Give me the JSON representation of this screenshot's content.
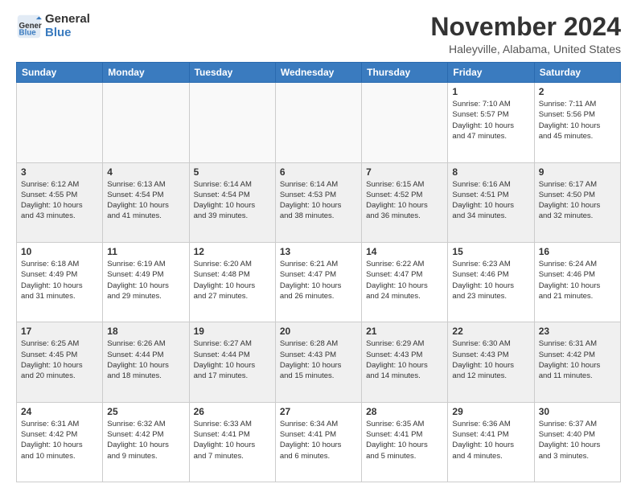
{
  "header": {
    "logo_general": "General",
    "logo_blue": "Blue",
    "month_title": "November 2024",
    "location": "Haleyville, Alabama, United States"
  },
  "weekdays": [
    "Sunday",
    "Monday",
    "Tuesday",
    "Wednesday",
    "Thursday",
    "Friday",
    "Saturday"
  ],
  "weeks": [
    [
      {
        "day": "",
        "info": ""
      },
      {
        "day": "",
        "info": ""
      },
      {
        "day": "",
        "info": ""
      },
      {
        "day": "",
        "info": ""
      },
      {
        "day": "",
        "info": ""
      },
      {
        "day": "1",
        "info": "Sunrise: 7:10 AM\nSunset: 5:57 PM\nDaylight: 10 hours\nand 47 minutes."
      },
      {
        "day": "2",
        "info": "Sunrise: 7:11 AM\nSunset: 5:56 PM\nDaylight: 10 hours\nand 45 minutes."
      }
    ],
    [
      {
        "day": "3",
        "info": "Sunrise: 6:12 AM\nSunset: 4:55 PM\nDaylight: 10 hours\nand 43 minutes."
      },
      {
        "day": "4",
        "info": "Sunrise: 6:13 AM\nSunset: 4:54 PM\nDaylight: 10 hours\nand 41 minutes."
      },
      {
        "day": "5",
        "info": "Sunrise: 6:14 AM\nSunset: 4:54 PM\nDaylight: 10 hours\nand 39 minutes."
      },
      {
        "day": "6",
        "info": "Sunrise: 6:14 AM\nSunset: 4:53 PM\nDaylight: 10 hours\nand 38 minutes."
      },
      {
        "day": "7",
        "info": "Sunrise: 6:15 AM\nSunset: 4:52 PM\nDaylight: 10 hours\nand 36 minutes."
      },
      {
        "day": "8",
        "info": "Sunrise: 6:16 AM\nSunset: 4:51 PM\nDaylight: 10 hours\nand 34 minutes."
      },
      {
        "day": "9",
        "info": "Sunrise: 6:17 AM\nSunset: 4:50 PM\nDaylight: 10 hours\nand 32 minutes."
      }
    ],
    [
      {
        "day": "10",
        "info": "Sunrise: 6:18 AM\nSunset: 4:49 PM\nDaylight: 10 hours\nand 31 minutes."
      },
      {
        "day": "11",
        "info": "Sunrise: 6:19 AM\nSunset: 4:49 PM\nDaylight: 10 hours\nand 29 minutes."
      },
      {
        "day": "12",
        "info": "Sunrise: 6:20 AM\nSunset: 4:48 PM\nDaylight: 10 hours\nand 27 minutes."
      },
      {
        "day": "13",
        "info": "Sunrise: 6:21 AM\nSunset: 4:47 PM\nDaylight: 10 hours\nand 26 minutes."
      },
      {
        "day": "14",
        "info": "Sunrise: 6:22 AM\nSunset: 4:47 PM\nDaylight: 10 hours\nand 24 minutes."
      },
      {
        "day": "15",
        "info": "Sunrise: 6:23 AM\nSunset: 4:46 PM\nDaylight: 10 hours\nand 23 minutes."
      },
      {
        "day": "16",
        "info": "Sunrise: 6:24 AM\nSunset: 4:46 PM\nDaylight: 10 hours\nand 21 minutes."
      }
    ],
    [
      {
        "day": "17",
        "info": "Sunrise: 6:25 AM\nSunset: 4:45 PM\nDaylight: 10 hours\nand 20 minutes."
      },
      {
        "day": "18",
        "info": "Sunrise: 6:26 AM\nSunset: 4:44 PM\nDaylight: 10 hours\nand 18 minutes."
      },
      {
        "day": "19",
        "info": "Sunrise: 6:27 AM\nSunset: 4:44 PM\nDaylight: 10 hours\nand 17 minutes."
      },
      {
        "day": "20",
        "info": "Sunrise: 6:28 AM\nSunset: 4:43 PM\nDaylight: 10 hours\nand 15 minutes."
      },
      {
        "day": "21",
        "info": "Sunrise: 6:29 AM\nSunset: 4:43 PM\nDaylight: 10 hours\nand 14 minutes."
      },
      {
        "day": "22",
        "info": "Sunrise: 6:30 AM\nSunset: 4:43 PM\nDaylight: 10 hours\nand 12 minutes."
      },
      {
        "day": "23",
        "info": "Sunrise: 6:31 AM\nSunset: 4:42 PM\nDaylight: 10 hours\nand 11 minutes."
      }
    ],
    [
      {
        "day": "24",
        "info": "Sunrise: 6:31 AM\nSunset: 4:42 PM\nDaylight: 10 hours\nand 10 minutes."
      },
      {
        "day": "25",
        "info": "Sunrise: 6:32 AM\nSunset: 4:42 PM\nDaylight: 10 hours\nand 9 minutes."
      },
      {
        "day": "26",
        "info": "Sunrise: 6:33 AM\nSunset: 4:41 PM\nDaylight: 10 hours\nand 7 minutes."
      },
      {
        "day": "27",
        "info": "Sunrise: 6:34 AM\nSunset: 4:41 PM\nDaylight: 10 hours\nand 6 minutes."
      },
      {
        "day": "28",
        "info": "Sunrise: 6:35 AM\nSunset: 4:41 PM\nDaylight: 10 hours\nand 5 minutes."
      },
      {
        "day": "29",
        "info": "Sunrise: 6:36 AM\nSunset: 4:41 PM\nDaylight: 10 hours\nand 4 minutes."
      },
      {
        "day": "30",
        "info": "Sunrise: 6:37 AM\nSunset: 4:40 PM\nDaylight: 10 hours\nand 3 minutes."
      }
    ]
  ],
  "colors": {
    "header_bg": "#3a7bbf",
    "alt_row_bg": "#f0f0f0",
    "empty_bg": "#f9f9f9"
  }
}
